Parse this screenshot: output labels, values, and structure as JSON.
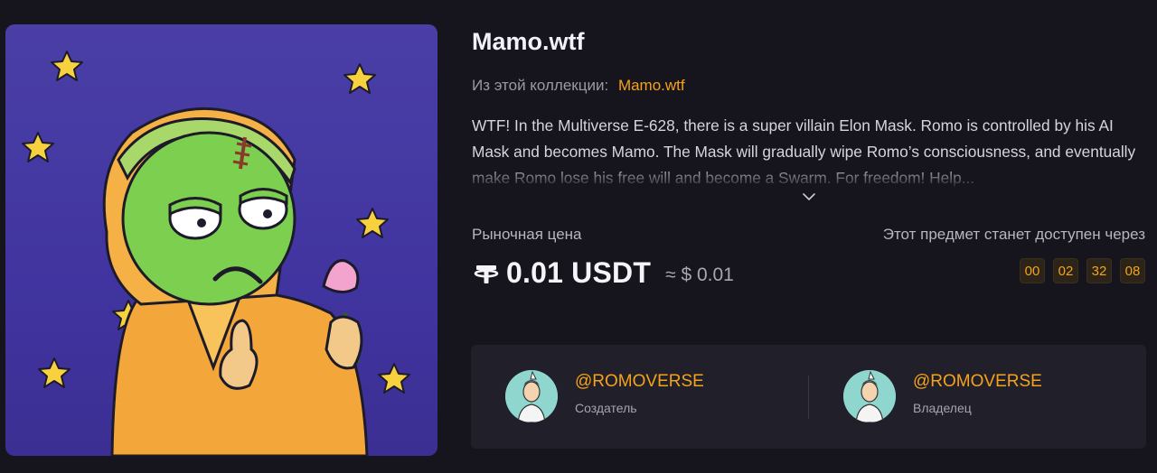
{
  "nft": {
    "title": "Mamo.wtf",
    "collection_label": "Из этой коллекции:",
    "collection_name": "Mamo.wtf",
    "description": "WTF! In the Multiverse E-628, there is a super villain Elon Mask. Romo is controlled by his AI Mask and becomes Mamo. The Mask will gradually wipe Romo’s consciousness, and eventually make Romo lose his free will and become a Swarm. For freedom! Help..."
  },
  "price": {
    "label": "Рыночная цена",
    "value": "0.01 USDT",
    "approx": "≈ $ 0.01",
    "currency_icon": "tether-icon"
  },
  "availability": {
    "label": "Этот предмет станет доступен через",
    "countdown": [
      "00",
      "02",
      "32",
      "08"
    ]
  },
  "creator": {
    "handle": "@ROMOVERSE",
    "role": "Создатель"
  },
  "owner": {
    "handle": "@ROMOVERSE",
    "role": "Владелец"
  },
  "colors": {
    "background": "#16141c",
    "accent": "#f4a31a",
    "card": "#211f29",
    "art_background": "#4a3fa6"
  }
}
